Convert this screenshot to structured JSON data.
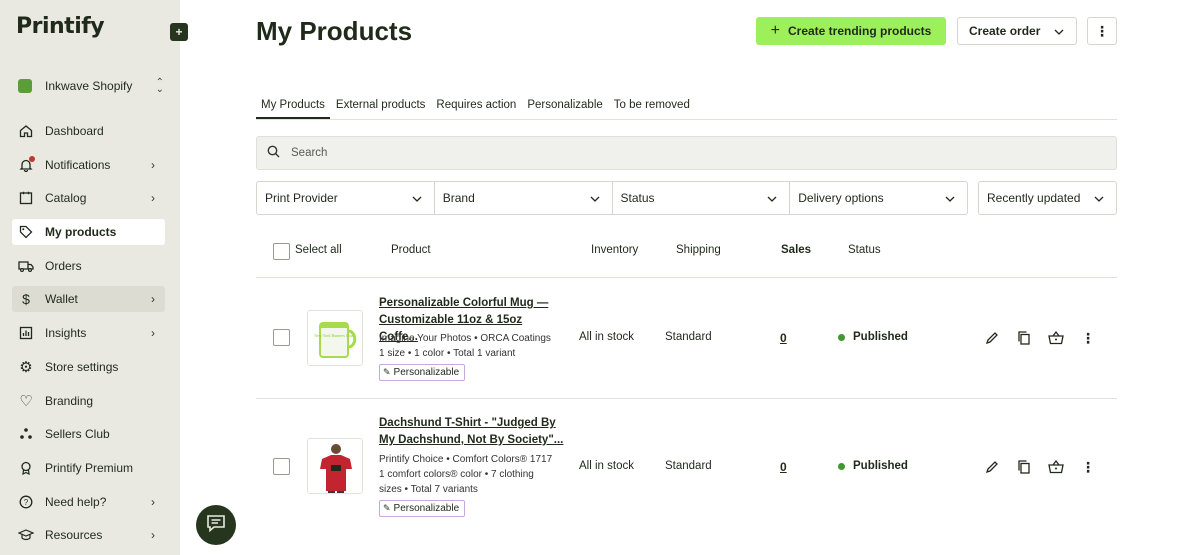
{
  "app": {
    "logo": "Printify"
  },
  "store": {
    "name": "Inkwave Shopify"
  },
  "nav": [
    {
      "label": "Dashboard",
      "icon": "home-icon",
      "chevron": false
    },
    {
      "label": "Notifications",
      "icon": "bell-icon",
      "chevron": true
    },
    {
      "label": "Catalog",
      "icon": "catalog-icon",
      "chevron": true
    },
    {
      "label": "My products",
      "icon": "tag-icon",
      "chevron": false,
      "active": true
    },
    {
      "label": "Orders",
      "icon": "truck-icon",
      "chevron": false
    },
    {
      "label": "Wallet",
      "icon": "dollar-icon",
      "chevron": true
    },
    {
      "label": "Insights",
      "icon": "chart-icon",
      "chevron": true
    },
    {
      "label": "Store settings",
      "icon": "gear-icon",
      "chevron": false
    },
    {
      "label": "Branding",
      "icon": "heart-icon",
      "chevron": false
    },
    {
      "label": "Sellers Club",
      "icon": "dots-icon",
      "chevron": false
    },
    {
      "label": "Printify Premium",
      "icon": "premium-icon",
      "chevron": false
    },
    {
      "label": "Need help?",
      "icon": "help-icon",
      "chevron": true
    },
    {
      "label": "Resources",
      "icon": "graduation-icon",
      "chevron": true
    }
  ],
  "header": {
    "title": "My Products",
    "create_trending_label": "Create trending products",
    "create_order_label": "Create order",
    "more_label": "⋮"
  },
  "tabs": [
    "My Products",
    "External products",
    "Requires action",
    "Personalizable",
    "To be removed"
  ],
  "search": {
    "placeholder": "Search"
  },
  "filters": [
    "Print Provider",
    "Brand",
    "Status",
    "Delivery options"
  ],
  "sort": {
    "label": "Recently updated"
  },
  "table": {
    "select_all": "Select all",
    "columns": {
      "product": "Product",
      "inventory": "Inventory",
      "shipping": "Shipping",
      "sales": "Sales",
      "status": "Status"
    }
  },
  "products": [
    {
      "name_line1": "Personalizable Colorful Mug —",
      "name_line2": "Customizable 11oz & 15oz Coffe...",
      "provider": "Imagine Your Photos • ORCA Coatings",
      "variants": "1 size • 1 color • Total 1 variant",
      "variants_line2": "",
      "tag": "Personalizable",
      "inventory": "All in stock",
      "shipping": "Standard",
      "sales": "0",
      "status": "Published",
      "thumb_text": "New York Runners Club"
    },
    {
      "name_line1": "Dachshund T-Shirt - \"Judged By",
      "name_line2": "My Dachshund, Not By Society\"...",
      "provider": "Printify Choice • Comfort Colors® 1717",
      "variants": "1 comfort colors® color • 7 clothing",
      "variants_line2": "sizes • Total 7 variants",
      "tag": "Personalizable",
      "inventory": "All in stock",
      "shipping": "Standard",
      "sales": "0",
      "status": "Published"
    }
  ],
  "colors": {
    "accent": "#9ef05a",
    "sidebar": "#e9e9e2",
    "published": "#3e9a2c",
    "brand_dark": "#26351e"
  }
}
